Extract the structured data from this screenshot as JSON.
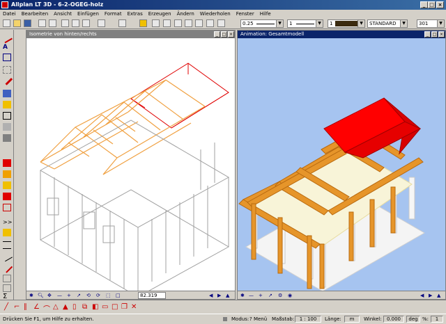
{
  "window": {
    "title": "Allplan LT 3D - 6-2-OGEG-holz"
  },
  "menu": [
    "Datei",
    "Bearbeiten",
    "Ansicht",
    "Einfügen",
    "Format",
    "Extras",
    "Erzeugen",
    "Ändern",
    "Wiederholen",
    "Fenster",
    "Hilfe"
  ],
  "toolbar": {
    "pen_value": "0.25",
    "line_value": "1",
    "color_value": "1",
    "style_value": "STANDARD",
    "layer_value": "301"
  },
  "left_pane": {
    "title": "Isometrie von hinten/rechts",
    "zoom": "82.319"
  },
  "right_pane": {
    "title": "Animation: Gesamtmodell"
  },
  "status": {
    "help": "Drücken Sie F1, um Hilfe zu erhalten.",
    "mode_label": "Modus:",
    "mode_value": "? Menü",
    "scale_label": "Maßstab:",
    "scale_value": "1 : 100",
    "length_label": "Länge:",
    "length_value": "m",
    "angle_label": "Winkel:",
    "angle_value": "0.000",
    "deg_value": "deg",
    "percent_label": "%:",
    "percent_value": "1"
  },
  "colors": {
    "title_active": "#0a246a",
    "roof_red": "#e00000",
    "timber": "#d68a1e",
    "sky": "#a6c4f0"
  }
}
